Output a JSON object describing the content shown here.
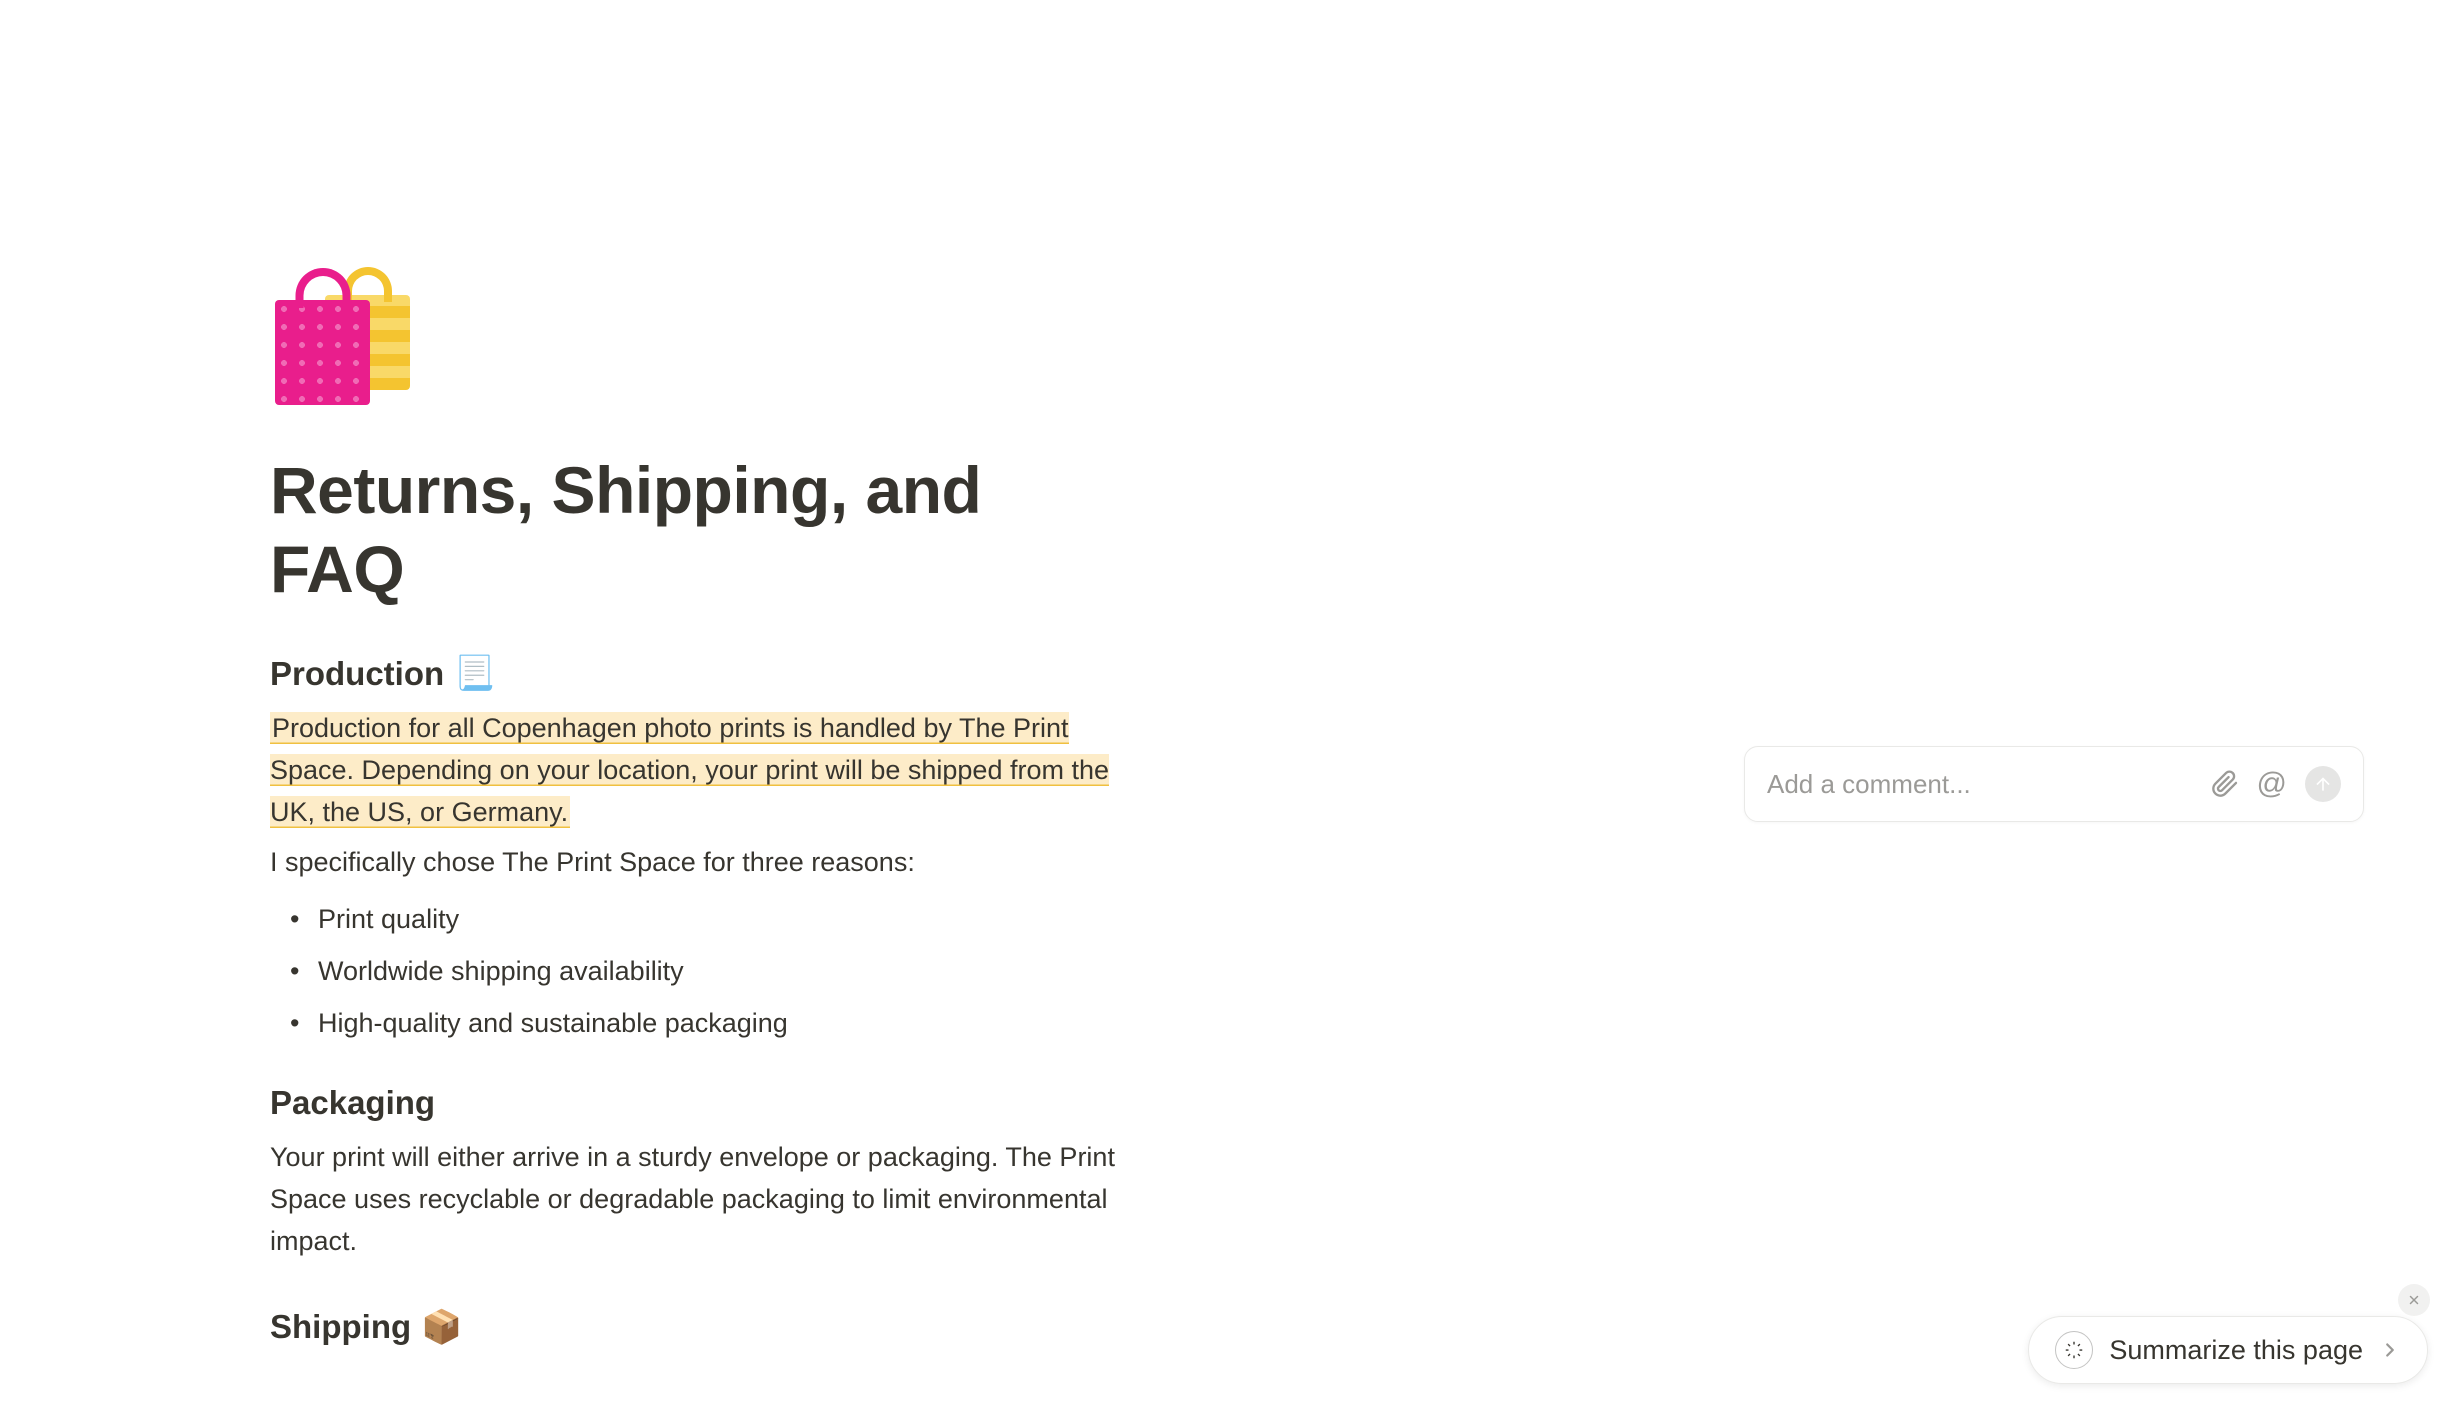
{
  "page": {
    "title": "Returns, Shipping, and FAQ",
    "icon_name": "shopping-bags"
  },
  "sections": {
    "production": {
      "heading": "Production",
      "heading_emoji": "📃",
      "highlighted_text": "Production for all Copenhagen photo prints is handled by The Print Space. Depending on your location, your print will be shipped from the UK, the US, or Germany.",
      "intro_text": "I specifically chose The Print Space for three reasons:",
      "bullets": [
        "Print quality",
        "Worldwide shipping availability",
        "High-quality and sustainable packaging"
      ]
    },
    "packaging": {
      "heading": "Packaging",
      "body": "Your print will either arrive in a sturdy envelope or packaging. The Print Space uses recyclable or degradable packaging to limit environmental impact."
    },
    "shipping": {
      "heading": "Shipping",
      "heading_emoji": "📦"
    }
  },
  "comment_box": {
    "placeholder": "Add a comment..."
  },
  "summarize": {
    "label": "Summarize this page"
  }
}
